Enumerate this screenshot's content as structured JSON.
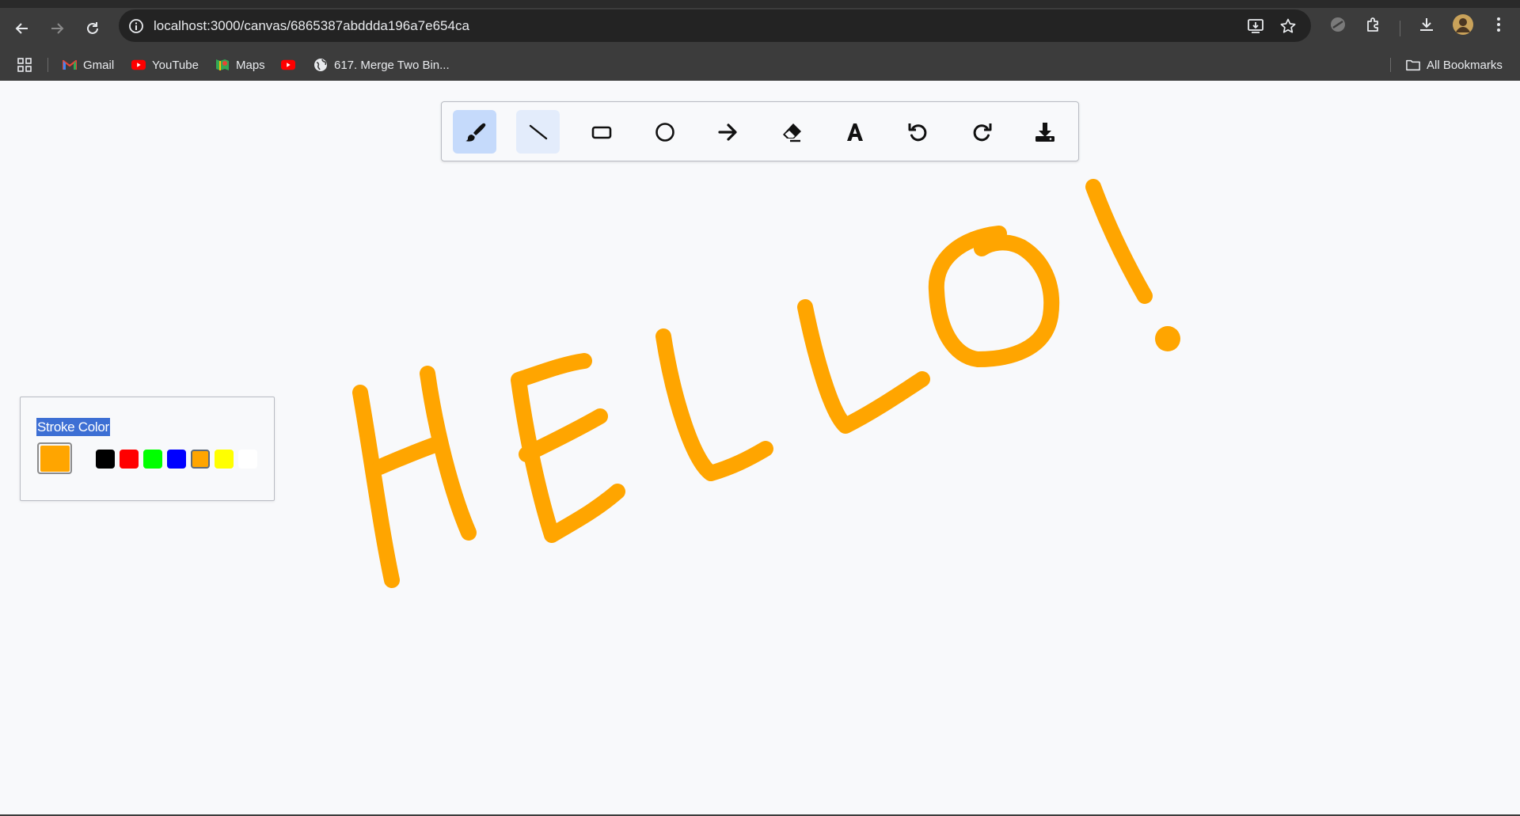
{
  "browser": {
    "url": "localhost:3000/canvas/6865387abddda196a7e654ca",
    "bookmarks": [
      {
        "label": "Gmail",
        "icon": "gmail-icon"
      },
      {
        "label": "YouTube",
        "icon": "youtube-icon"
      },
      {
        "label": "Maps",
        "icon": "maps-icon"
      },
      {
        "label": "",
        "icon": "youtube-icon"
      },
      {
        "label": "617. Merge Two Bin...",
        "icon": "globe-icon"
      }
    ],
    "all_bookmarks_label": "All Bookmarks"
  },
  "toolbar": {
    "tools": [
      {
        "name": "pencil",
        "icon": "brush-icon",
        "state": "active"
      },
      {
        "name": "line",
        "icon": "line-icon",
        "state": "hover"
      },
      {
        "name": "rectangle",
        "icon": "rectangle-icon",
        "state": "normal"
      },
      {
        "name": "circle",
        "icon": "circle-icon",
        "state": "normal"
      },
      {
        "name": "arrow",
        "icon": "arrow-right-icon",
        "state": "normal"
      },
      {
        "name": "eraser",
        "icon": "eraser-icon",
        "state": "normal"
      },
      {
        "name": "text",
        "icon": "text-icon",
        "state": "normal"
      },
      {
        "name": "undo",
        "icon": "undo-icon",
        "state": "normal"
      },
      {
        "name": "redo",
        "icon": "redo-icon",
        "state": "normal"
      },
      {
        "name": "download",
        "icon": "download-icon",
        "state": "normal"
      }
    ]
  },
  "color_panel": {
    "label": "Stroke Color",
    "current_color": "#FFA500",
    "swatches": [
      "#000000",
      "#FF0000",
      "#00FF00",
      "#0000FF",
      "#FFA500",
      "#FFFF00",
      "#FFFFFF"
    ],
    "selected_swatch": "#FFA500"
  },
  "drawing": {
    "stroke_color": "#FFA500",
    "chrome_background": "#3C3C3C",
    "canvas_background": "#F8F9FB"
  }
}
